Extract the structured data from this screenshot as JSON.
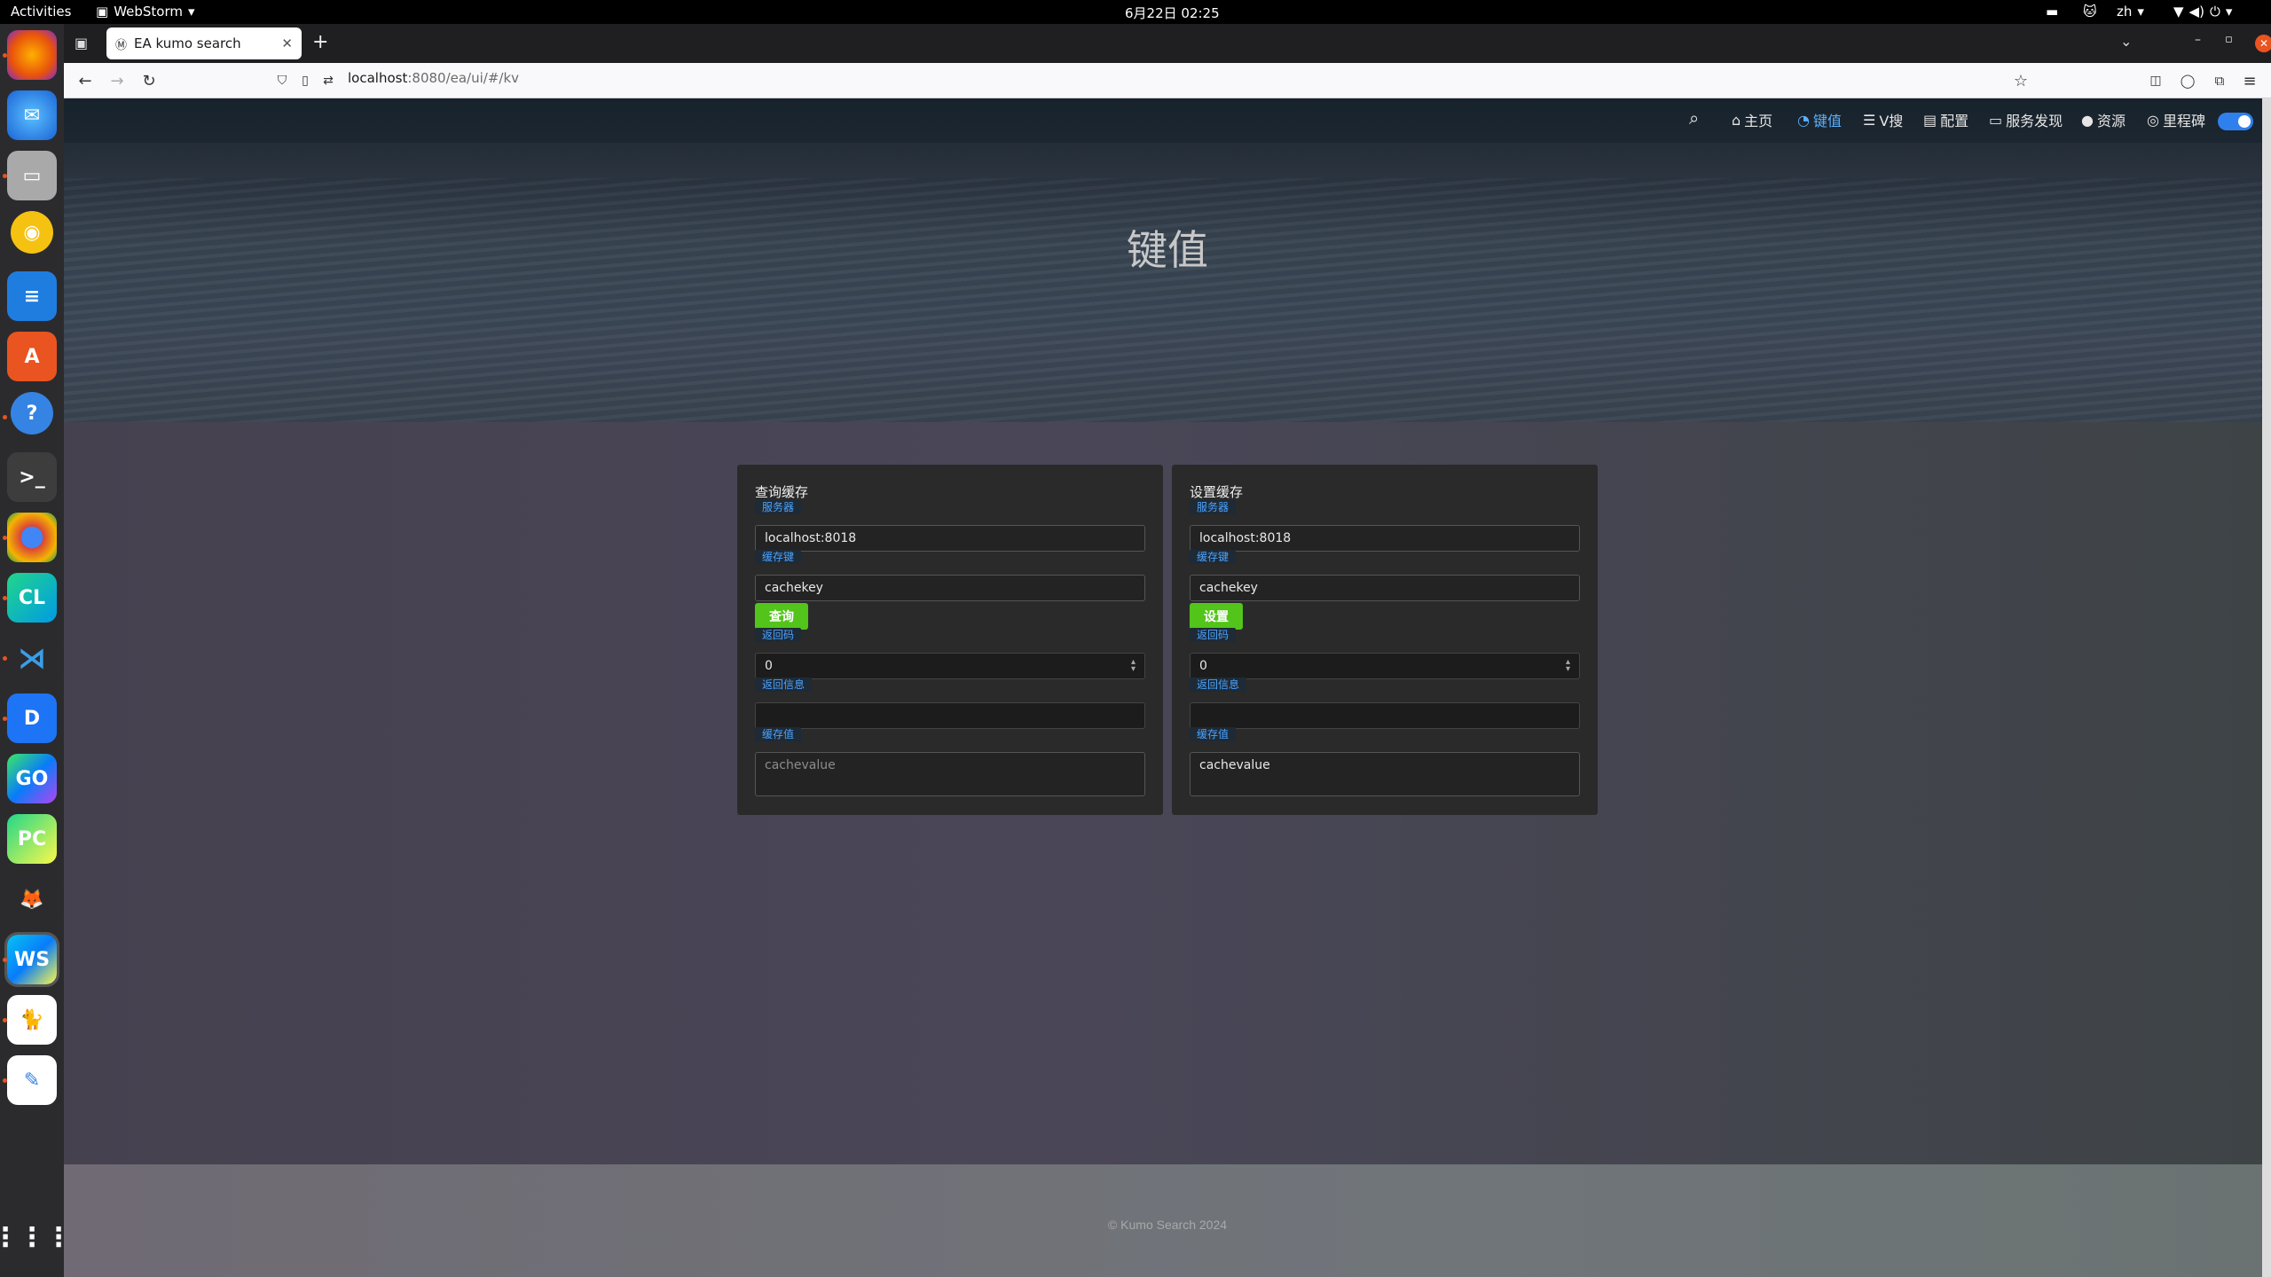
{
  "system": {
    "activities": "Activities",
    "app_name": "WebStorm",
    "datetime": "6月22日  02:25",
    "lang": "zh"
  },
  "browser": {
    "tab_title": "EA kumo search",
    "url_host": "localhost",
    "url_rest": ":8080/ea/ui/#/kv"
  },
  "nav": {
    "items": [
      "主页",
      "键值",
      "V搜",
      "配置",
      "服务发现",
      "资源",
      "里程碑"
    ],
    "active_index": 1
  },
  "page_title": "键值",
  "query_card": {
    "title": "查询缓存",
    "server_label": "服务器",
    "server_value": "localhost:8018",
    "key_label": "缓存键",
    "key_value": "cachekey",
    "button": "查询",
    "code_label": "返回码",
    "code_value": "0",
    "msg_label": "返回信息",
    "msg_value": "",
    "value_label": "缓存值",
    "value_placeholder": "cachevalue"
  },
  "set_card": {
    "title": "设置缓存",
    "server_label": "服务器",
    "server_value": "localhost:8018",
    "key_label": "缓存键",
    "key_value": "cachekey",
    "button": "设置",
    "code_label": "返回码",
    "code_value": "0",
    "msg_label": "返回信息",
    "msg_value": "",
    "value_label": "缓存值",
    "value_value": "cachevalue"
  },
  "footer": "© Kumo Search 2024",
  "colors": {
    "accent": "#52c41a",
    "link": "#4ba3ff",
    "active_nav": "#5cb0ff"
  }
}
